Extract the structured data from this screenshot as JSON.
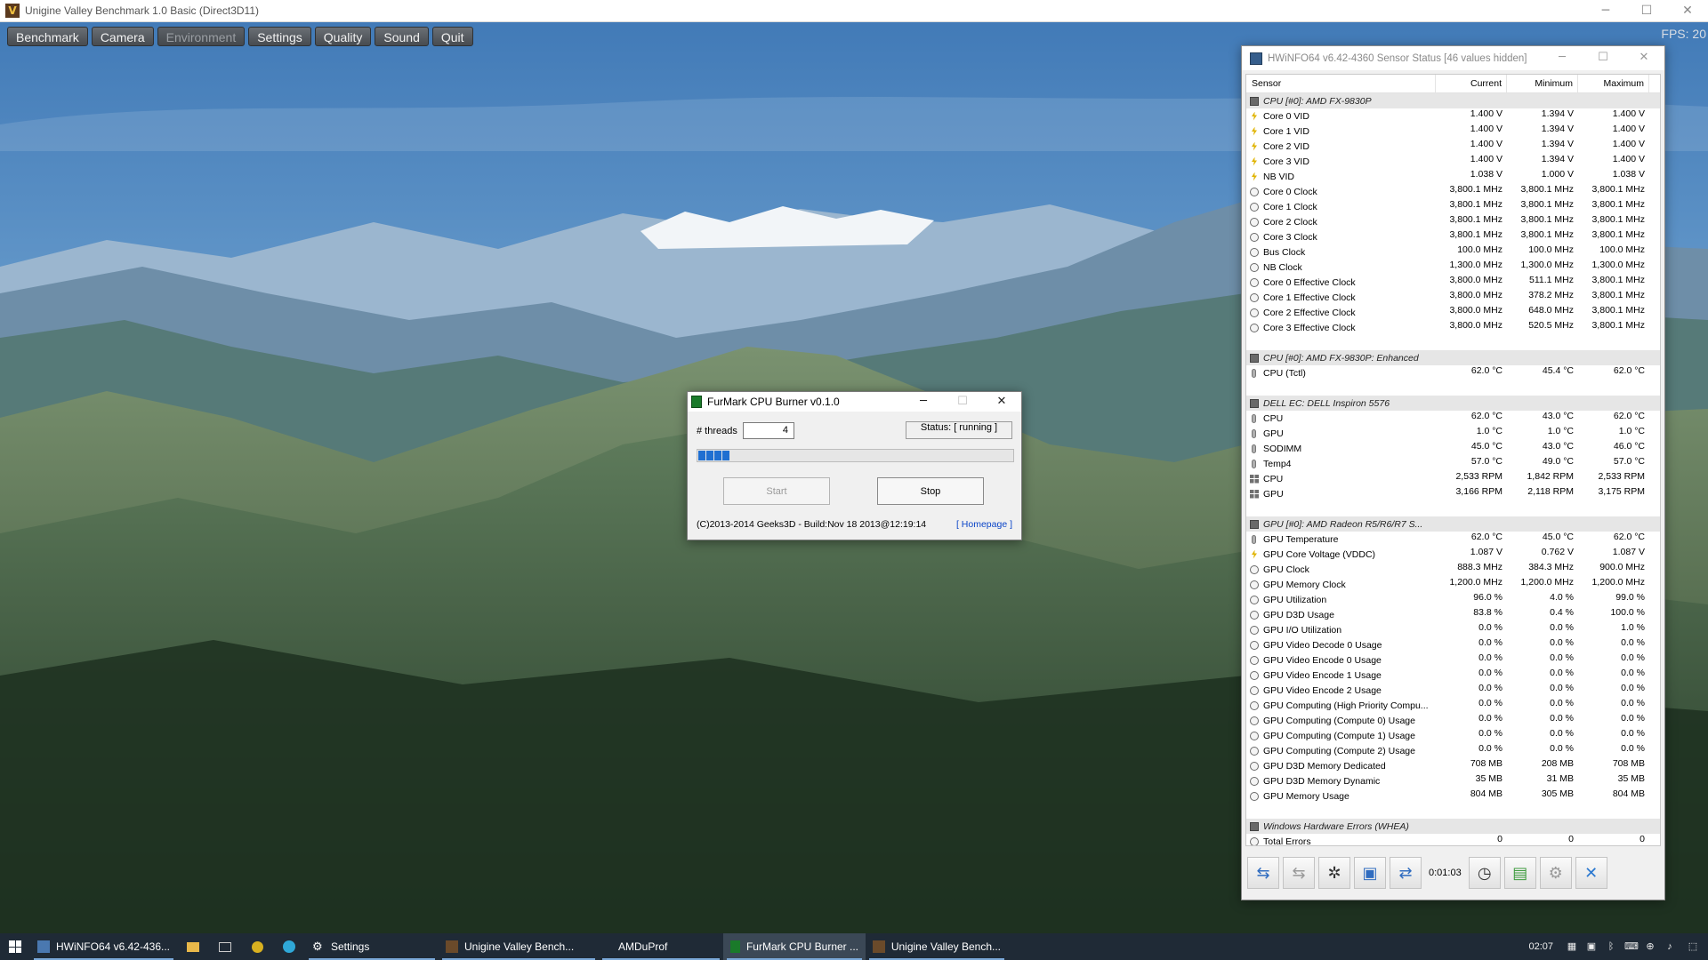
{
  "app": {
    "title": "Unigine Valley Benchmark 1.0 Basic (Direct3D11)",
    "icon": "unigine-v-icon",
    "window_controls": [
      "─",
      "☐",
      "✕"
    ]
  },
  "bench_menu": {
    "items": [
      {
        "label": "Benchmark",
        "enabled": true
      },
      {
        "label": "Camera",
        "enabled": true
      },
      {
        "label": "Environment",
        "enabled": false
      },
      {
        "label": "Settings",
        "enabled": true
      },
      {
        "label": "Quality",
        "enabled": true
      },
      {
        "label": "Sound",
        "enabled": true
      },
      {
        "label": "Quit",
        "enabled": true
      }
    ],
    "fps": "FPS: 20"
  },
  "furmark": {
    "title": "FurMark CPU Burner v0.1.0",
    "threads_label": "# threads",
    "threads_value": "4",
    "status": "Status: [ running ]",
    "progress_segments": 4,
    "start_label": "Start",
    "stop_label": "Stop",
    "copyright": "(C)2013-2014 Geeks3D - Build:Nov 18 2013@12:19:14",
    "homepage": "[ Homepage ]",
    "controls": [
      "─",
      "☐",
      "✕"
    ]
  },
  "hwinfo": {
    "title": "HWiNFO64 v6.42-4360 Sensor Status [46 values hidden]",
    "controls": [
      "─",
      "☐",
      "✕"
    ],
    "columns": [
      "Sensor",
      "Current",
      "Minimum",
      "Maximum"
    ],
    "rows": [
      {
        "t": "hdr",
        "name": "CPU [#0]: AMD FX-9830P"
      },
      {
        "t": "bolt",
        "name": "Core 0 VID",
        "cur": "1.400 V",
        "min": "1.394 V",
        "max": "1.400 V"
      },
      {
        "t": "bolt",
        "name": "Core 1 VID",
        "cur": "1.400 V",
        "min": "1.394 V",
        "max": "1.400 V"
      },
      {
        "t": "bolt",
        "name": "Core 2 VID",
        "cur": "1.400 V",
        "min": "1.394 V",
        "max": "1.400 V"
      },
      {
        "t": "bolt",
        "name": "Core 3 VID",
        "cur": "1.400 V",
        "min": "1.394 V",
        "max": "1.400 V"
      },
      {
        "t": "bolt",
        "name": "NB VID",
        "cur": "1.038 V",
        "min": "1.000 V",
        "max": "1.038 V"
      },
      {
        "t": "clock",
        "name": "Core 0 Clock",
        "cur": "3,800.1 MHz",
        "min": "3,800.1 MHz",
        "max": "3,800.1 MHz"
      },
      {
        "t": "clock",
        "name": "Core 1 Clock",
        "cur": "3,800.1 MHz",
        "min": "3,800.1 MHz",
        "max": "3,800.1 MHz"
      },
      {
        "t": "clock",
        "name": "Core 2 Clock",
        "cur": "3,800.1 MHz",
        "min": "3,800.1 MHz",
        "max": "3,800.1 MHz"
      },
      {
        "t": "clock",
        "name": "Core 3 Clock",
        "cur": "3,800.1 MHz",
        "min": "3,800.1 MHz",
        "max": "3,800.1 MHz"
      },
      {
        "t": "clock",
        "name": "Bus Clock",
        "cur": "100.0 MHz",
        "min": "100.0 MHz",
        "max": "100.0 MHz"
      },
      {
        "t": "clock",
        "name": "NB Clock",
        "cur": "1,300.0 MHz",
        "min": "1,300.0 MHz",
        "max": "1,300.0 MHz"
      },
      {
        "t": "clock",
        "name": "Core 0 Effective Clock",
        "cur": "3,800.0 MHz",
        "min": "511.1 MHz",
        "max": "3,800.1 MHz"
      },
      {
        "t": "clock",
        "name": "Core 1 Effective Clock",
        "cur": "3,800.0 MHz",
        "min": "378.2 MHz",
        "max": "3,800.1 MHz"
      },
      {
        "t": "clock",
        "name": "Core 2 Effective Clock",
        "cur": "3,800.0 MHz",
        "min": "648.0 MHz",
        "max": "3,800.1 MHz"
      },
      {
        "t": "clock",
        "name": "Core 3 Effective Clock",
        "cur": "3,800.0 MHz",
        "min": "520.5 MHz",
        "max": "3,800.1 MHz"
      },
      {
        "t": "blank"
      },
      {
        "t": "hdr",
        "name": "CPU [#0]: AMD FX-9830P: Enhanced"
      },
      {
        "t": "therm",
        "name": "CPU (Tctl)",
        "cur": "62.0 °C",
        "min": "45.4 °C",
        "max": "62.0 °C"
      },
      {
        "t": "blank"
      },
      {
        "t": "hdr",
        "name": "DELL EC: DELL Inspiron 5576"
      },
      {
        "t": "therm",
        "name": "CPU",
        "cur": "62.0 °C",
        "min": "43.0 °C",
        "max": "62.0 °C"
      },
      {
        "t": "therm",
        "name": "GPU",
        "cur": "1.0 °C",
        "min": "1.0 °C",
        "max": "1.0 °C"
      },
      {
        "t": "therm",
        "name": "SODIMM",
        "cur": "45.0 °C",
        "min": "43.0 °C",
        "max": "46.0 °C"
      },
      {
        "t": "therm",
        "name": "Temp4",
        "cur": "57.0 °C",
        "min": "49.0 °C",
        "max": "57.0 °C"
      },
      {
        "t": "fan",
        "name": "CPU",
        "cur": "2,533 RPM",
        "min": "1,842 RPM",
        "max": "2,533 RPM"
      },
      {
        "t": "fan",
        "name": "GPU",
        "cur": "3,166 RPM",
        "min": "2,118 RPM",
        "max": "3,175 RPM"
      },
      {
        "t": "blank"
      },
      {
        "t": "hdr",
        "name": "GPU [#0]: AMD Radeon R5/R6/R7 S..."
      },
      {
        "t": "therm",
        "name": "GPU Temperature",
        "cur": "62.0 °C",
        "min": "45.0 °C",
        "max": "62.0 °C"
      },
      {
        "t": "bolt",
        "name": "GPU Core Voltage (VDDC)",
        "cur": "1.087 V",
        "min": "0.762 V",
        "max": "1.087 V"
      },
      {
        "t": "clock",
        "name": "GPU Clock",
        "cur": "888.3 MHz",
        "min": "384.3 MHz",
        "max": "900.0 MHz"
      },
      {
        "t": "clock",
        "name": "GPU Memory Clock",
        "cur": "1,200.0 MHz",
        "min": "1,200.0 MHz",
        "max": "1,200.0 MHz"
      },
      {
        "t": "clock",
        "name": "GPU Utilization",
        "cur": "96.0 %",
        "min": "4.0 %",
        "max": "99.0 %"
      },
      {
        "t": "clock",
        "name": "GPU D3D Usage",
        "cur": "83.8 %",
        "min": "0.4 %",
        "max": "100.0 %"
      },
      {
        "t": "clock",
        "name": "GPU I/O Utilization",
        "cur": "0.0 %",
        "min": "0.0 %",
        "max": "1.0 %"
      },
      {
        "t": "clock",
        "name": "GPU Video Decode 0 Usage",
        "cur": "0.0 %",
        "min": "0.0 %",
        "max": "0.0 %"
      },
      {
        "t": "clock",
        "name": "GPU Video Encode 0 Usage",
        "cur": "0.0 %",
        "min": "0.0 %",
        "max": "0.0 %"
      },
      {
        "t": "clock",
        "name": "GPU Video Encode 1 Usage",
        "cur": "0.0 %",
        "min": "0.0 %",
        "max": "0.0 %"
      },
      {
        "t": "clock",
        "name": "GPU Video Encode 2 Usage",
        "cur": "0.0 %",
        "min": "0.0 %",
        "max": "0.0 %"
      },
      {
        "t": "clock",
        "name": "GPU Computing (High Priority Compu...",
        "cur": "0.0 %",
        "min": "0.0 %",
        "max": "0.0 %"
      },
      {
        "t": "clock",
        "name": "GPU Computing (Compute 0) Usage",
        "cur": "0.0 %",
        "min": "0.0 %",
        "max": "0.0 %"
      },
      {
        "t": "clock",
        "name": "GPU Computing (Compute 1) Usage",
        "cur": "0.0 %",
        "min": "0.0 %",
        "max": "0.0 %"
      },
      {
        "t": "clock",
        "name": "GPU Computing (Compute 2) Usage",
        "cur": "0.0 %",
        "min": "0.0 %",
        "max": "0.0 %"
      },
      {
        "t": "clock",
        "name": "GPU D3D Memory Dedicated",
        "cur": "708 MB",
        "min": "208 MB",
        "max": "708 MB"
      },
      {
        "t": "clock",
        "name": "GPU D3D Memory Dynamic",
        "cur": "35 MB",
        "min": "31 MB",
        "max": "35 MB"
      },
      {
        "t": "clock",
        "name": "GPU Memory Usage",
        "cur": "804 MB",
        "min": "305 MB",
        "max": "804 MB"
      },
      {
        "t": "blank"
      },
      {
        "t": "hdr",
        "name": "Windows Hardware Errors (WHEA)"
      },
      {
        "t": "clock",
        "name": "Total Errors",
        "cur": "0",
        "min": "0",
        "max": "0"
      }
    ],
    "toolbar": {
      "timer": "0:01:03",
      "buttons": [
        "back-arrows-icon",
        "forward-arrows-icon",
        "fan-settings-icon",
        "monitor-report-icon",
        "network-icon",
        "clock-icon",
        "add-log-icon",
        "settings-gear-icon",
        "close-x-icon"
      ]
    }
  },
  "taskbar": {
    "tasks": [
      {
        "label": "HWiNFO64 v6.42-436...",
        "icon": "hwinfo-icon",
        "active": false
      },
      {
        "label": "Unigine Valley Bench...",
        "icon": "unigine-icon",
        "active": false
      },
      {
        "label": "AMDuProf",
        "icon": "",
        "active": false
      },
      {
        "label": "FurMark CPU Burner ...",
        "icon": "furmark-icon",
        "active": true
      },
      {
        "label": "Unigine Valley Bench...",
        "icon": "unigine-icon",
        "active": false
      }
    ],
    "settings_label": "Settings",
    "clock": "02:07"
  }
}
